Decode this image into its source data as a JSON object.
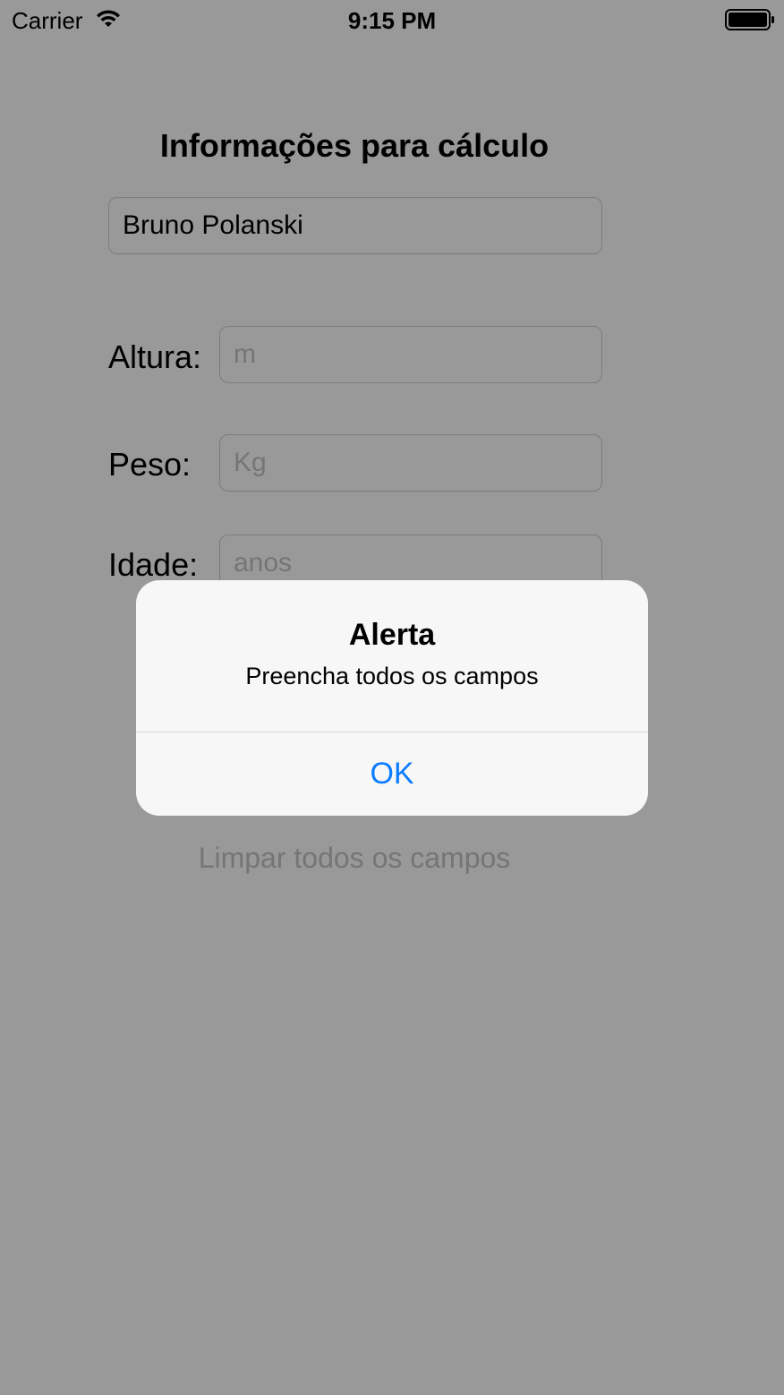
{
  "status_bar": {
    "carrier": "Carrier",
    "time": "9:15 PM",
    "wifi_icon": "wifi-icon",
    "battery_icon": "battery-icon"
  },
  "form": {
    "title": "Informações para cálculo",
    "name_value": "Bruno Polanski",
    "height_label": "Altura:",
    "height_placeholder": "m",
    "weight_label": "Peso:",
    "weight_placeholder": "Kg",
    "age_label": "Idade:",
    "age_placeholder": "anos",
    "clear_label": "Limpar todos os campos"
  },
  "alert": {
    "title": "Alerta",
    "message": "Preencha todos os campos",
    "ok_label": "OK"
  },
  "colors": {
    "accent": "#0a7cff",
    "overlay": "rgba(0,0,0,0.40)"
  }
}
